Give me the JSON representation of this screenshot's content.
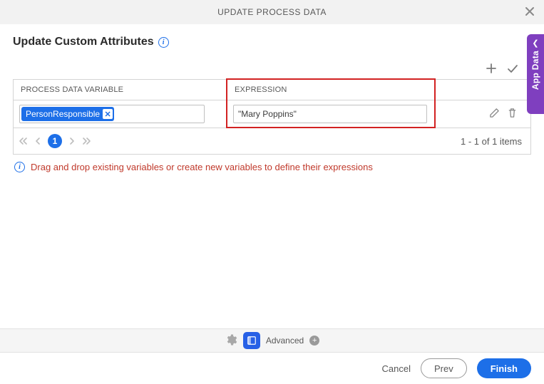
{
  "header": {
    "title": "UPDATE PROCESS DATA"
  },
  "section": {
    "title": "Update Custom Attributes"
  },
  "table": {
    "columns": {
      "variable": "PROCESS DATA VARIABLE",
      "expression": "EXPRESSION"
    },
    "rows": [
      {
        "variable": "PersonResponsible",
        "expression": "\"Mary Poppins\""
      }
    ]
  },
  "pager": {
    "current": "1",
    "summary": "1 - 1 of 1 items"
  },
  "hint": "Drag and drop existing variables or create new variables to define their expressions",
  "advanced": {
    "label": "Advanced"
  },
  "footer": {
    "cancel": "Cancel",
    "prev": "Prev",
    "finish": "Finish"
  },
  "side_tab": {
    "label": "App Data"
  }
}
